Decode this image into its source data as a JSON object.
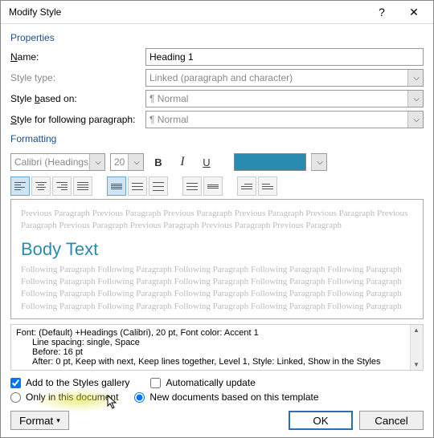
{
  "title": "Modify Style",
  "sections": {
    "properties": "Properties",
    "formatting": "Formatting"
  },
  "labels": {
    "name": "Name:",
    "style_type": "Style type:",
    "based_on": "Style based on:",
    "following": "Style for following paragraph:"
  },
  "fields": {
    "name_value": "Heading 1",
    "style_type_value": "Linked (paragraph and character)",
    "based_on_value": "¶ Normal",
    "following_value": "¶ Normal"
  },
  "font": {
    "family": "Calibri (Headings)",
    "size": "20"
  },
  "color_swatch": "#2a8bb0",
  "preview": {
    "prev": "Previous Paragraph Previous Paragraph Previous Paragraph Previous Paragraph Previous Paragraph Previous Paragraph Previous Paragraph Previous Paragraph Previous Paragraph Previous Paragraph",
    "body": "Body Text",
    "foll": "Following Paragraph Following Paragraph Following Paragraph Following Paragraph Following Paragraph Following Paragraph Following Paragraph Following Paragraph Following Paragraph Following Paragraph Following Paragraph Following Paragraph Following Paragraph Following Paragraph Following Paragraph Following Paragraph Following Paragraph Following Paragraph Following Paragraph Following Paragraph"
  },
  "description": {
    "l1": "Font: (Default) +Headings (Calibri), 20 pt, Font color: Accent 1",
    "l2": "Line spacing:  single, Space",
    "l3": "Before:  16 pt",
    "l4": "After:  0 pt, Keep with next, Keep lines together, Level 1, Style: Linked, Show in the Styles"
  },
  "checks": {
    "add_gallery": "Add to the Styles gallery",
    "auto_update": "Automatically update",
    "only_doc": "Only in this document",
    "new_docs": "New documents based on this template"
  },
  "buttons": {
    "format": "Format",
    "ok": "OK",
    "cancel": "Cancel"
  }
}
